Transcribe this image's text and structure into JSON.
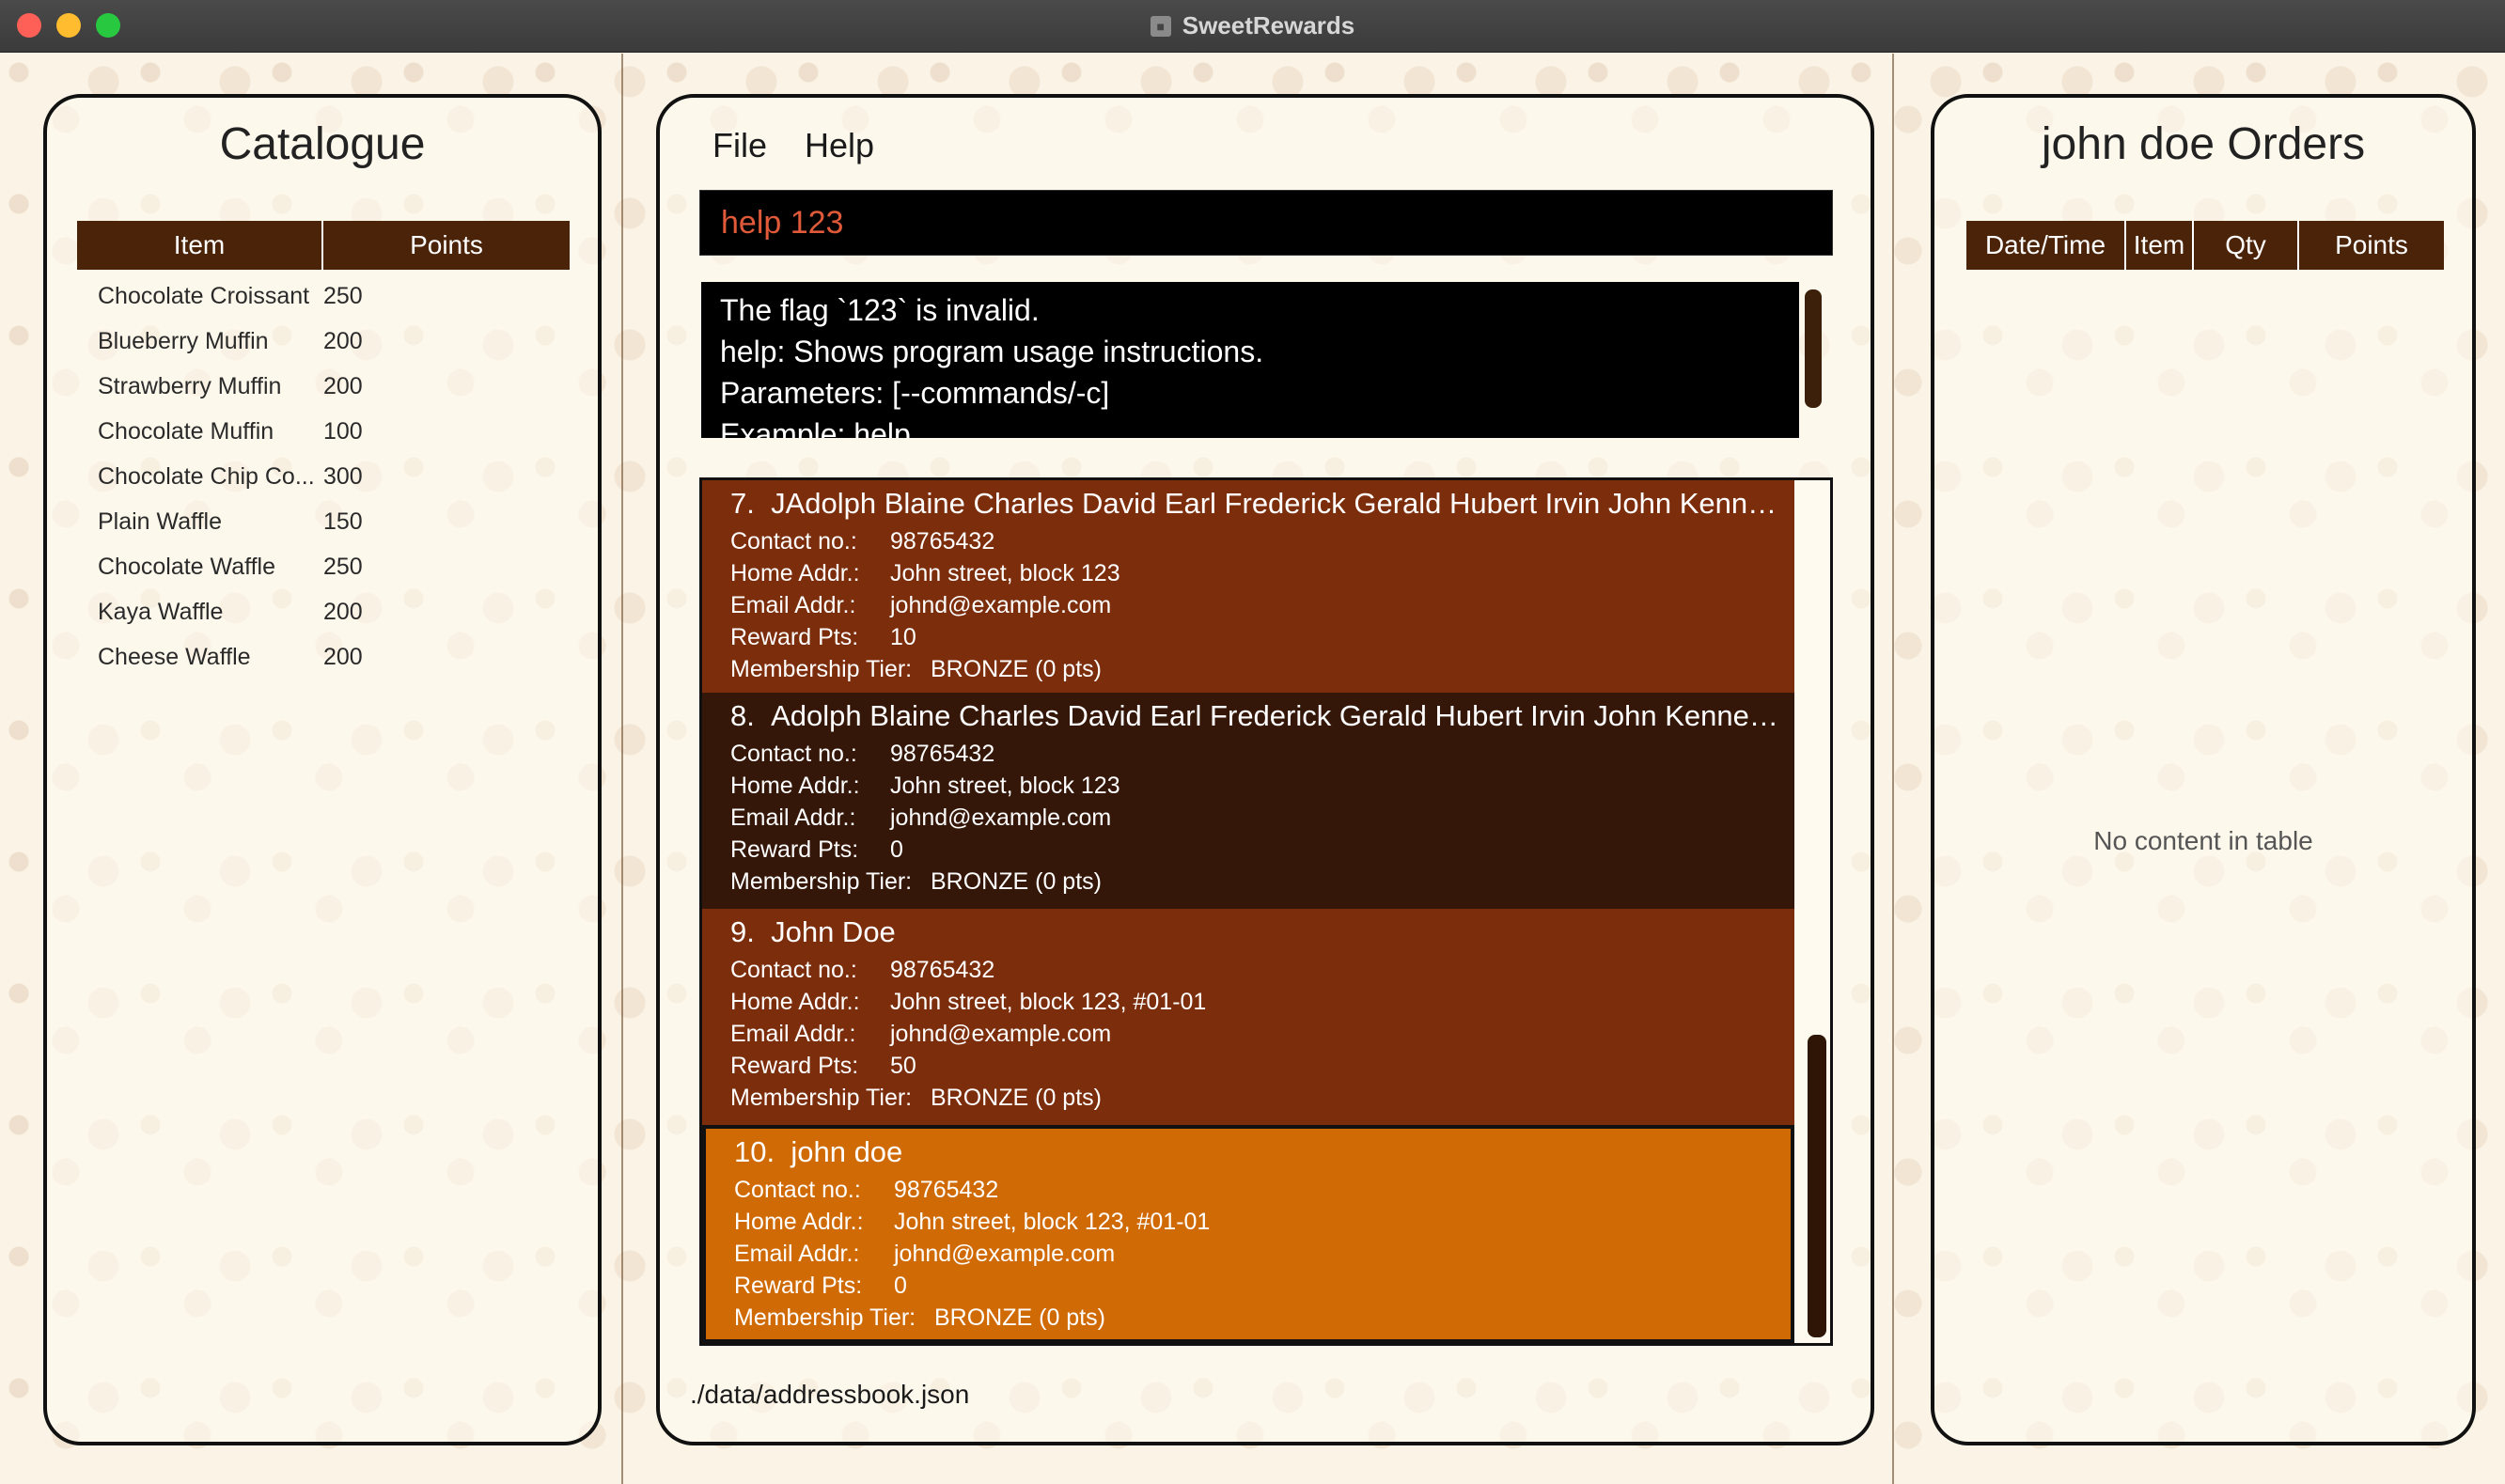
{
  "window": {
    "title": "SweetRewards"
  },
  "catalogue": {
    "title": "Catalogue",
    "columns": [
      "Item",
      "Points"
    ],
    "rows": [
      {
        "item": "Chocolate Croissant",
        "points": "250"
      },
      {
        "item": "Blueberry Muffin",
        "points": "200"
      },
      {
        "item": "Strawberry Muffin",
        "points": "200"
      },
      {
        "item": "Chocolate Muffin",
        "points": "100"
      },
      {
        "item": "Chocolate Chip Co...",
        "points": "300"
      },
      {
        "item": "Plain Waffle",
        "points": "150"
      },
      {
        "item": "Chocolate Waffle",
        "points": "250"
      },
      {
        "item": "Kaya Waffle",
        "points": "200"
      },
      {
        "item": "Cheese Waffle",
        "points": "200"
      }
    ]
  },
  "menu": {
    "file": "File",
    "help": "Help"
  },
  "command": {
    "value": "help 123"
  },
  "result": {
    "lines": [
      "The flag `123` is invalid.",
      "help: Shows program usage instructions.",
      "Parameters: [--commands/-c]",
      "Example: help"
    ]
  },
  "labels": {
    "contact": "Contact no.:",
    "home": "Home Addr.:",
    "email": "Email Addr.:",
    "reward": "Reward Pts:",
    "tier": "Membership Tier:"
  },
  "customers": [
    {
      "index": "7.",
      "name": "JAdolph Blaine Charles David Earl Frederick Gerald Hubert Irvin John Kenneth L...",
      "contact": "98765432",
      "home": "John street, block 123",
      "email": "johnd@example.com",
      "reward": "10",
      "tier": "BRONZE (0 pts)"
    },
    {
      "index": "8.",
      "name": "Adolph Blaine Charles David Earl Frederick Gerald Hubert Irvin John Kenneth Ll...",
      "contact": "98765432",
      "home": "John street, block 123",
      "email": "johnd@example.com",
      "reward": "0",
      "tier": "BRONZE (0 pts)"
    },
    {
      "index": "9.",
      "name": "John Doe",
      "contact": "98765432",
      "home": "John street, block 123, #01-01",
      "email": "johnd@example.com",
      "reward": "50",
      "tier": "BRONZE (0 pts)"
    },
    {
      "index": "10.",
      "name": "john doe",
      "contact": "98765432",
      "home": "John street, block 123, #01-01",
      "email": "johnd@example.com",
      "reward": "0",
      "tier": "BRONZE (0 pts)"
    }
  ],
  "status": {
    "path": "./data/addressbook.json"
  },
  "orders": {
    "title": "john doe Orders",
    "columns": [
      "Date/Time",
      "Item",
      "Qty",
      "Points"
    ],
    "empty": "No content in table"
  },
  "colors": {
    "header": "#4a2308",
    "card_odd": "#7c2d0b",
    "card_even": "#341708",
    "card_selected": "#d06a05",
    "command_text": "#e05a3a"
  }
}
